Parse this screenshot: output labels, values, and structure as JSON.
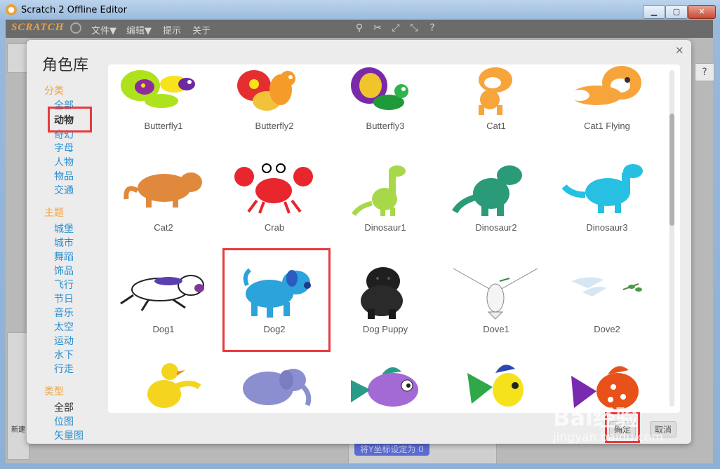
{
  "window": {
    "title": "Scratch 2 Offline Editor",
    "minimize": "▁",
    "maximize": "▢",
    "close": "✕"
  },
  "menubar": {
    "logo": "SCRATCH",
    "items": [
      "文件▼",
      "编辑▼",
      "提示",
      "关于"
    ]
  },
  "dialog": {
    "title": "角色库",
    "close": "✕"
  },
  "sidebar": {
    "category_heading": "分类",
    "categories": [
      "全部",
      "动物",
      "奇幻",
      "字母",
      "人物",
      "物品",
      "交通"
    ],
    "theme_heading": "主题",
    "themes": [
      "城堡",
      "城市",
      "舞蹈",
      "饰品",
      "飞行",
      "节日",
      "音乐",
      "太空",
      "运动",
      "水下",
      "行走"
    ],
    "type_heading": "类型",
    "types": [
      "全部",
      "位图",
      "矢量图"
    ]
  },
  "sprites": [
    "Butterfly1",
    "Butterfly2",
    "Butterfly3",
    "Cat1",
    "Cat1 Flying",
    "Cat2",
    "Crab",
    "Dinosaur1",
    "Dinosaur2",
    "Dinosaur3",
    "Dog1",
    "Dog2",
    "Dog Puppy",
    "Dove1",
    "Dove2",
    "",
    "",
    "",
    "",
    ""
  ],
  "buttons": {
    "ok": "确定",
    "cancel": "取消"
  },
  "background": {
    "new_sprite": "新建",
    "block_pill": "将Y坐标设定为 0"
  },
  "watermark": {
    "brand": "Bai经验",
    "url": "jingyan.baidu.com"
  }
}
